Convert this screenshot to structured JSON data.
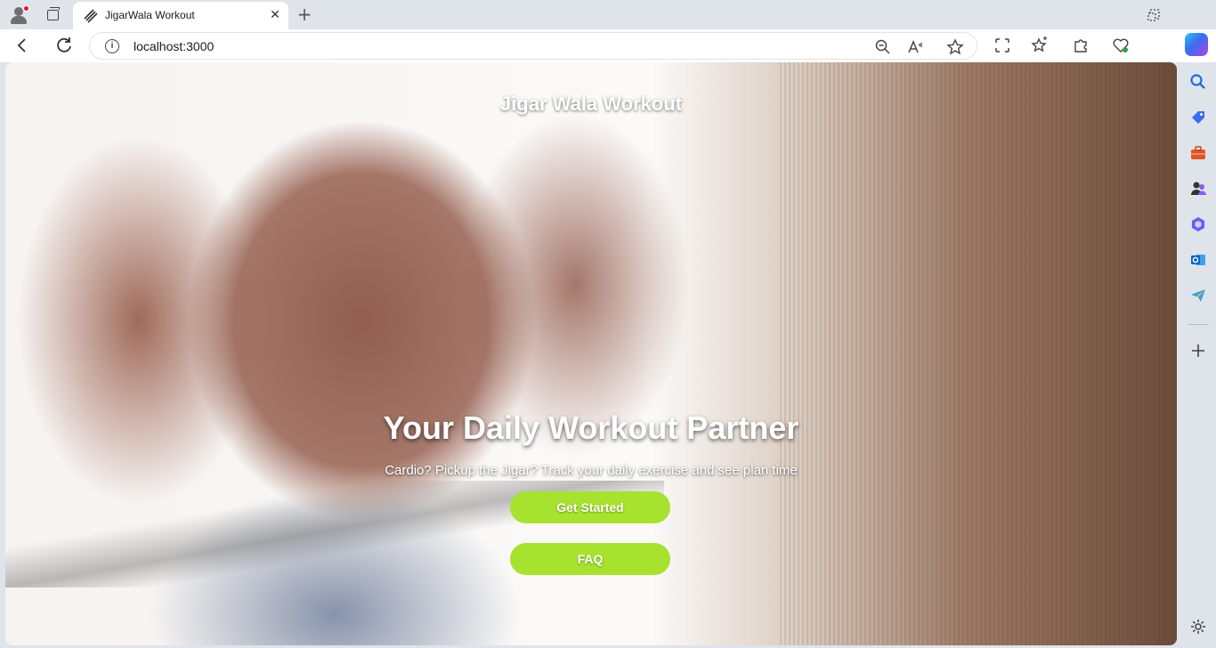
{
  "browser": {
    "tab": {
      "title": "JigarWala Workout",
      "close_glyph": "✕"
    },
    "new_tab_glyph": "+",
    "address": {
      "url": "localhost:3000",
      "info_glyph": "i"
    },
    "toolbar_icons": [
      "zoom-out-icon",
      "read-aloud-icon",
      "favorite-star-icon",
      "split-screen-icon",
      "favorites-icon",
      "extensions-icon",
      "browser-essentials-icon",
      "copilot-icon"
    ],
    "sidebar_icons": [
      "search-icon",
      "shopping-tag-icon",
      "tools-icon",
      "people-icon",
      "m365-icon",
      "outlook-icon",
      "telegram-icon",
      "add-icon",
      "settings-icon"
    ]
  },
  "page": {
    "site_title": "Jigar Wala Workout",
    "hero_heading": "Your Daily Workout Partner",
    "hero_subtitle": "Cardio? Pickup the Jigar? Track your daily exercise and see plan time",
    "buttons": {
      "get_started": "Get Started",
      "faq": "FAQ"
    }
  },
  "colors": {
    "cta_green": "#a6e22e",
    "chrome_bg": "#dfe3ea"
  }
}
